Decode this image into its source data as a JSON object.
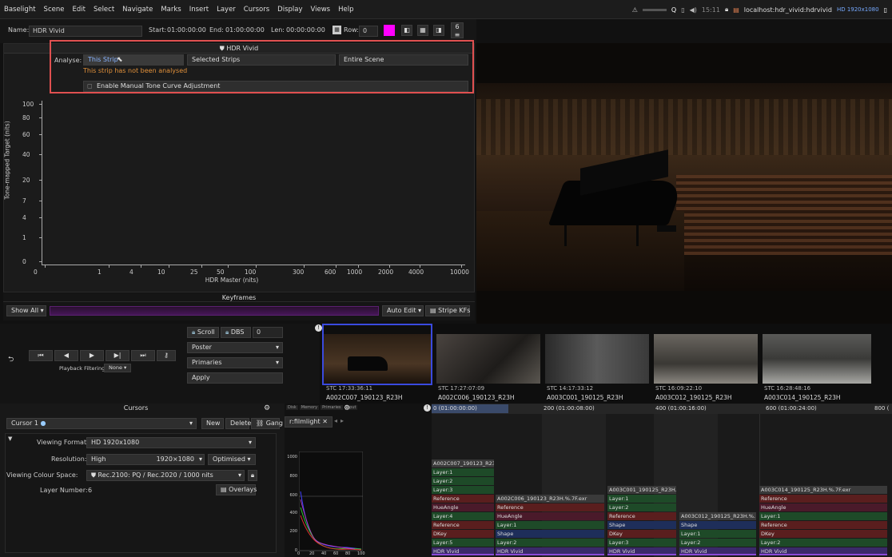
{
  "menubar": {
    "items": [
      "Baselight",
      "Scene",
      "Edit",
      "Select",
      "Navigate",
      "Marks",
      "Insert",
      "Layer",
      "Cursors",
      "Display",
      "Views",
      "Help"
    ],
    "tray": {
      "clock": "15:11",
      "location": "localhost:hdr_vivid:hdrvivid",
      "format": "HD 1920x1080"
    }
  },
  "toolbar": {
    "name_label": "Name:",
    "name_value": "HDR Vivid",
    "start_label": "Start:",
    "start_value": "01:00:00:00",
    "end_label": "End:",
    "end_value": "01:00:00:00",
    "len_label": "Len:",
    "len_value": "00:00:00:00",
    "row_label": "Row:",
    "row_value": "0",
    "counter": "6",
    "accent": "#ff00ff"
  },
  "hdr_panel": {
    "title": "HDR Vivid",
    "analyse_label": "Analyse:",
    "buttons": [
      "This Strip",
      "Selected Strips",
      "Entire Scene"
    ],
    "warning": "This strip has not been analysed",
    "manual_label": "Enable Manual Tone Curve Adjustment",
    "highlight_color": "#e05050"
  },
  "graph": {
    "ylabel": "Tone-mapped Target (nits)",
    "xlabel": "HDR Master (nits)",
    "yticks": [
      "100",
      "80",
      "60",
      "40",
      "20",
      "7",
      "4",
      "1",
      "0"
    ],
    "xticks": [
      "0",
      "1",
      "4",
      "10",
      "25",
      "50",
      "100",
      "300",
      "600",
      "1000",
      "2000",
      "4000",
      "10000"
    ]
  },
  "keyframes": {
    "title": "Keyframes",
    "show_all": "Show All",
    "auto_edit": "Auto Edit",
    "stripe_kfs": "Stripe KFs"
  },
  "playback": {
    "scroll": "Scroll",
    "dbs": "DBS",
    "dbs_value": "0",
    "poster": "Poster",
    "primaries": "Primaries",
    "apply": "Apply",
    "filter_label": "Playback Filtering:",
    "filter_value": "None"
  },
  "strips": [
    {
      "stc": "STC 17:33:36:11",
      "tn": "A002C007_190123_R23H"
    },
    {
      "stc": "STC 17:27:07:09",
      "tn": "A002C006_190123_R23H"
    },
    {
      "stc": "STC 14:17:33:12",
      "tn": "A003C001_190125_R23H"
    },
    {
      "stc": "STC 16:09:22:10",
      "tn": "A003C012_190125_R23H"
    },
    {
      "stc": "STC 16:28:48:16",
      "tn": "A003C014_190125_R23H"
    }
  ],
  "cursors": {
    "title": "Cursors",
    "cursor_name": "Cursor 1",
    "new": "New",
    "delete": "Delete",
    "gang": "Gang",
    "viewing_format_label": "Viewing Format:",
    "viewing_format": "HD 1920x1080",
    "resolution_label": "Resolution:",
    "resolution": "High",
    "resolution_dims": "1920×1080",
    "resolution_mode": "Optimised",
    "colour_space_label": "Viewing Colour Space:",
    "colour_space": "Rec.2100: PQ / Rec.2020 / 1000 nits",
    "layer_number_label": "Layer Number:",
    "layer_number": "6",
    "overlays": "Overlays"
  },
  "scope": {
    "tab": "r:filmlight",
    "tabs": [
      "Disk",
      "Memory",
      "Primaries",
      "Input"
    ],
    "yticks": [
      "1000",
      "800",
      "600",
      "400",
      "200",
      "0"
    ],
    "xticks": [
      "0",
      "20",
      "40",
      "60",
      "80",
      "100"
    ]
  },
  "timeline": {
    "rulers": [
      "0 (01:00:00:00)",
      "200 (01:00:08:00)",
      "400 (01:00:16:00)",
      "600 (01:00:24:00)",
      "800 ("
    ],
    "col1": [
      "A002C007_190123_R23",
      "Layer:1",
      "Layer:2",
      "Layer:3",
      "Reference",
      "HueAngle",
      "Layer:4",
      "Reference",
      "DKey",
      "Layer:5",
      "HDR Vivid"
    ],
    "col2": [
      "A002C006_190123_R23H.%.7F.exr",
      "Reference",
      "HueAngle",
      "Layer:1",
      "Shape",
      "Layer:2",
      "HDR Vivid"
    ],
    "col3": [
      "A003C001_190125_R23H.",
      "Layer:1",
      "Layer:2",
      "Reference",
      "Shape",
      "DKey",
      "Layer:3",
      "HDR Vivid"
    ],
    "col4": [
      "A003C012_190125_R23H.%.",
      "Shape",
      "Layer:1",
      "Layer:2",
      "HDR Vivid"
    ],
    "col5": [
      "A003C014_190125_R23H.%.7F.exr",
      "Reference",
      "HueAngle",
      "Layer:1",
      "Reference",
      "DKey",
      "Layer:2",
      "HDR Vivid"
    ]
  }
}
